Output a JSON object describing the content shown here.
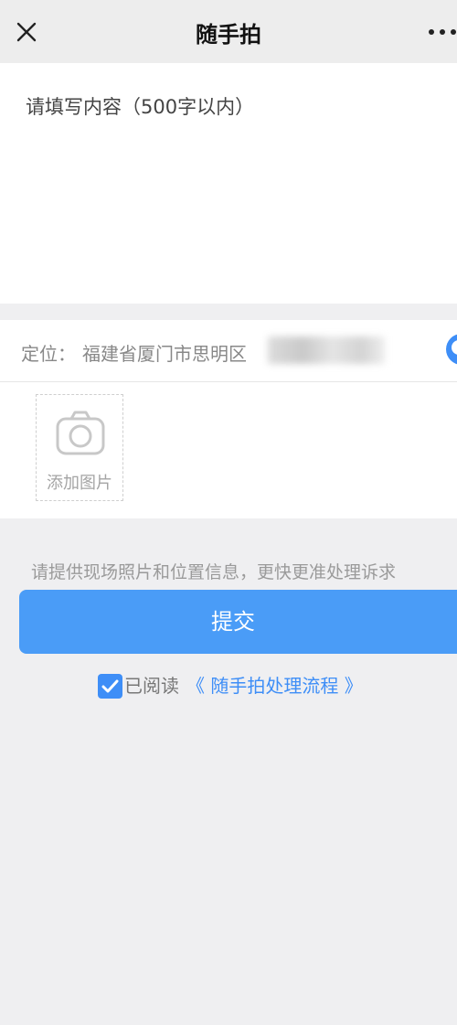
{
  "header": {
    "title": "随手拍"
  },
  "form": {
    "content_placeholder": "请填写内容（500字以内）",
    "location_label": "定位：",
    "location_value": "福建省厦门市思明区",
    "add_photo_label": "添加图片"
  },
  "tip": "请提供现场照片和位置信息，更快更准处理诉求",
  "submit_label": "提交",
  "agreement": {
    "prefix": "已阅读",
    "link_text": "《 随手拍处理流程 》"
  },
  "colors": {
    "accent": "#3e8ef7",
    "submit": "#4a9cf7",
    "background": "#efeff1"
  },
  "icons": [
    "close-icon",
    "more-icon",
    "locate-icon",
    "camera-icon",
    "checkbox-checked-icon"
  ]
}
